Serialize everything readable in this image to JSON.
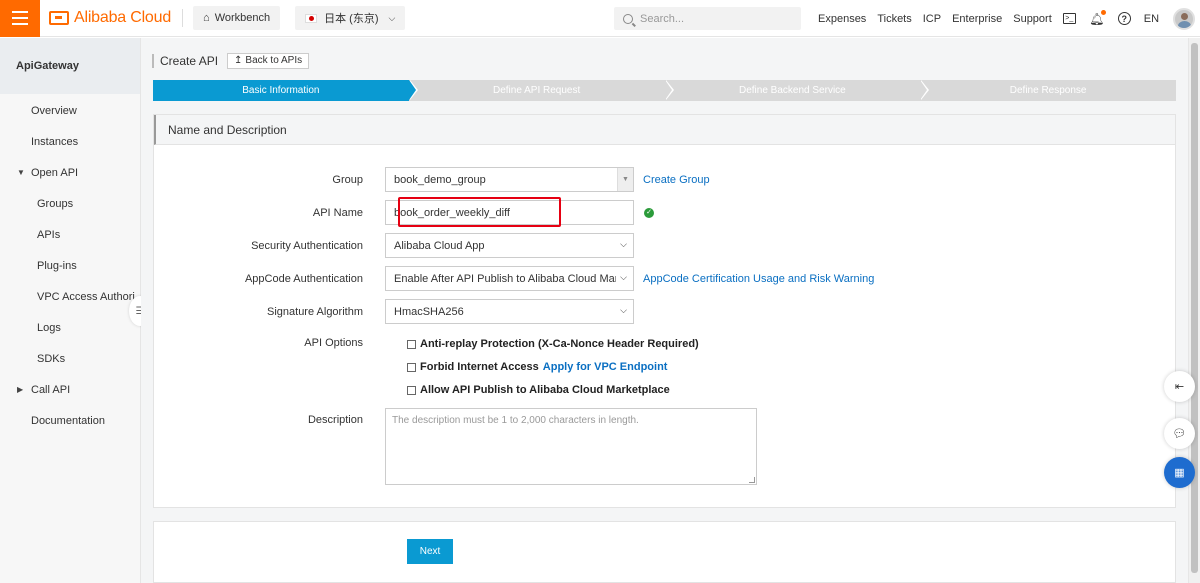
{
  "topbar": {
    "brand": "Alibaba Cloud",
    "workbench": "Workbench",
    "region": "日本 (东京)",
    "search_placeholder": "Search...",
    "links": [
      "Expenses",
      "Tickets",
      "ICP",
      "Enterprise",
      "Support"
    ],
    "language": "EN",
    "accent_color": "#ff6a00"
  },
  "sidebar": {
    "title": "ApiGateway",
    "items": [
      {
        "label": "Overview"
      },
      {
        "label": "Instances"
      },
      {
        "label": "Open API"
      },
      {
        "label": "Groups"
      },
      {
        "label": "APIs"
      },
      {
        "label": "Plug-ins"
      },
      {
        "label": "VPC Access Authori..."
      },
      {
        "label": "Logs"
      },
      {
        "label": "SDKs"
      },
      {
        "label": "Call API"
      },
      {
        "label": "Documentation"
      }
    ]
  },
  "header": {
    "title": "Create API",
    "back_label": "Back to APIs"
  },
  "steps": [
    {
      "label": "Basic Information",
      "active": true
    },
    {
      "label": "Define API Request",
      "active": false
    },
    {
      "label": "Define Backend Service",
      "active": false
    },
    {
      "label": "Define Response",
      "active": false
    }
  ],
  "form": {
    "section_title": "Name and Description",
    "group": {
      "label": "Group",
      "value": "book_demo_group",
      "link": "Create Group"
    },
    "api_name": {
      "label": "API Name",
      "value": "book_order_weekly_diff"
    },
    "security_auth": {
      "label": "Security Authentication",
      "value": "Alibaba Cloud App"
    },
    "appcode_auth": {
      "label": "AppCode Authentication",
      "value": "Enable After API Publish to Alibaba Cloud Marketplace",
      "link": "AppCode Certification Usage and Risk Warning"
    },
    "signature_algorithm": {
      "label": "Signature Algorithm",
      "value": "HmacSHA256"
    },
    "api_options": {
      "label": "API Options",
      "options": [
        {
          "label": "Anti-replay Protection (X-Ca-Nonce Header Required)",
          "checked": false
        },
        {
          "label": "Forbid Internet Access",
          "link": "Apply for VPC Endpoint",
          "checked": false
        },
        {
          "label": "Allow API Publish to Alibaba Cloud Marketplace",
          "checked": false
        }
      ]
    },
    "description": {
      "label": "Description",
      "placeholder": "The description must be 1 to 2,000 characters in length."
    }
  },
  "footer": {
    "next_label": "Next"
  },
  "colors": {
    "primary": "#0a9ad2",
    "link": "#0a6fc2",
    "highlight": "#e60012",
    "success": "#2b9b3a"
  }
}
